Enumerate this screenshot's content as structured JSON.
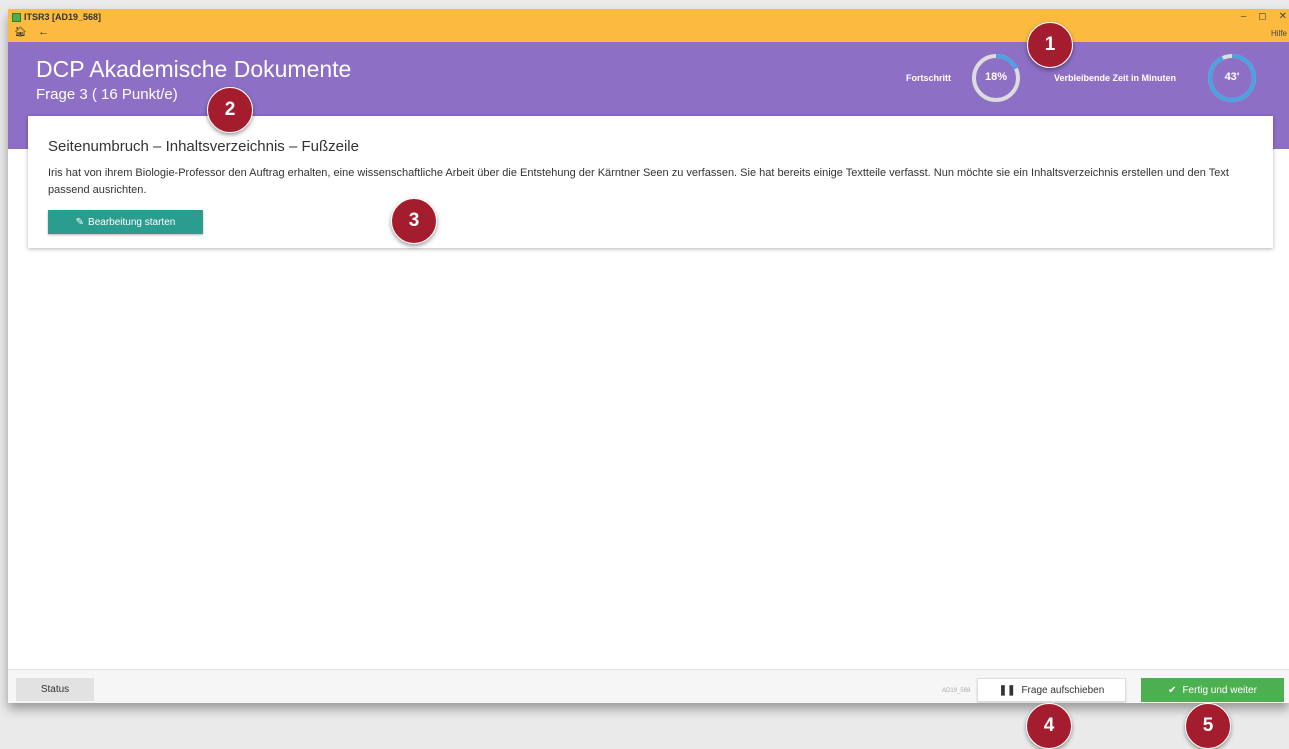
{
  "window": {
    "app_title": "ITSR3 [AD19_568]",
    "help": "Hilfe",
    "controls": [
      "–",
      "◻",
      "✕"
    ]
  },
  "header": {
    "course_title": "DCP Akademische Dokumente",
    "question_title": "Frage 3 ( 16 Punkt/e)",
    "progress_label": "Fortschritt",
    "progress_value": "18%",
    "progress_fraction": 0.18,
    "time_label": "Verbleibende Zeit in Minuten",
    "time_value": "43'",
    "time_fraction": 0.93
  },
  "task": {
    "heading": "Seitenumbruch – Inhaltsverzeichnis – Fußzeile",
    "description": "Iris hat von ihrem Biologie-Professor den Auftrag erhalten, eine wissenschaftliche Arbeit über die Entstehung der Kärntner Seen zu verfassen. Sie hat bereits einige Textteile verfasst. Nun möchte sie ein Inhaltsverzeichnis erstellen und den Text passend ausrichten.",
    "start_label": "Bearbeitung starten"
  },
  "footer": {
    "status_label": "Status",
    "question_code": "AD19_568",
    "defer_label": "Frage aufschieben",
    "finish_label": "Fertig und weiter"
  },
  "markers": [
    "1",
    "2",
    "3",
    "4",
    "5"
  ],
  "colors": {
    "titlebar": "#fcbb3f",
    "header": "#8d6fc6",
    "start_button": "#2a9d8f",
    "finish_button": "#4caf50",
    "marker": "#a41d2e",
    "ring_progress": "#4aa3df"
  }
}
